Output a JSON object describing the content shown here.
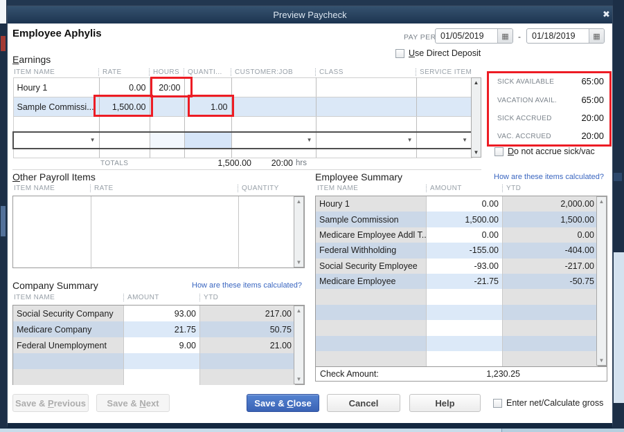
{
  "window": {
    "title": "Preview Paycheck",
    "close_icon": "✖"
  },
  "header": {
    "employee_name": "Employee Aphylis",
    "pay_period_label": {
      "pre": "PAY PER",
      "key": "I",
      "post": "OD"
    },
    "pay_period_start": "01/05/2019",
    "pay_period_separator": "-",
    "pay_period_end": "01/18/2019",
    "calendar_icon": "▦",
    "use_direct_deposit": {
      "pre": "",
      "key": "U",
      "post": "se Direct Deposit"
    }
  },
  "earnings": {
    "title": {
      "pre": "",
      "key": "E",
      "post": "arnings"
    },
    "columns": [
      "ITEM NAME",
      "RATE",
      "HOURS",
      "QUANTI...",
      "CUSTOMER:JOB",
      "CLASS",
      "SERVICE ITEM"
    ],
    "rows": [
      {
        "item": "Houry 1",
        "rate": "0.00",
        "hours": "20:00",
        "quantity": "",
        "customer_job": "",
        "class": "",
        "service_item": ""
      },
      {
        "item": "Sample Commissi...",
        "rate": "1,500.00",
        "hours": "",
        "quantity": "1.00",
        "customer_job": "",
        "class": "",
        "service_item": ""
      },
      {
        "item": "",
        "rate": "",
        "hours": "",
        "quantity": "",
        "customer_job": "",
        "class": "",
        "service_item": ""
      },
      {
        "item": "",
        "rate": "",
        "hours": "",
        "quantity": "",
        "customer_job": "",
        "class": "",
        "service_item": ""
      },
      {
        "item": "",
        "rate": "",
        "hours": "",
        "quantity": "",
        "customer_job": "",
        "class": "",
        "service_item": ""
      }
    ],
    "dropdown_icon": "▼",
    "totals_label": "TOTALS",
    "totals": {
      "rate": "1,500.00",
      "hours": "20:00",
      "hours_unit": "hrs"
    }
  },
  "sick_vacation": {
    "rows": [
      {
        "label": "SICK AVAILABLE",
        "value": "65:00"
      },
      {
        "label": "VACATION AVAIL.",
        "value": "65:00"
      },
      {
        "label": "SICK ACCRUED",
        "value": "20:00"
      },
      {
        "label": "VAC. ACCRUED",
        "value": "20:00"
      }
    ],
    "do_not_accrue": {
      "pre": "",
      "key": "D",
      "post": "o not accrue sick/vac"
    }
  },
  "other_payroll_items": {
    "title": {
      "pre": "",
      "key": "O",
      "post": "ther Payroll Items"
    },
    "columns": [
      "ITEM NAME",
      "RATE",
      "QUANTITY"
    ]
  },
  "employee_summary": {
    "title": "Employee Summary",
    "link": "How are these items calculated?",
    "columns": [
      "ITEM NAME",
      "AMOUNT",
      "YTD"
    ],
    "rows": [
      [
        "Houry 1",
        "0.00",
        "2,000.00"
      ],
      [
        "Sample Commission",
        "1,500.00",
        "1,500.00"
      ],
      [
        "Medicare Employee Addl T...",
        "0.00",
        "0.00"
      ],
      [
        "Federal Withholding",
        "-155.00",
        "-404.00"
      ],
      [
        "Social Security Employee",
        "-93.00",
        "-217.00"
      ],
      [
        "Medicare Employee",
        "-21.75",
        "-50.75"
      ],
      [
        "",
        "",
        ""
      ],
      [
        "",
        "",
        ""
      ],
      [
        "",
        "",
        ""
      ],
      [
        "",
        "",
        ""
      ],
      [
        "",
        "",
        ""
      ]
    ],
    "check_amount_label": "Check Amount:",
    "check_amount_value": "1,230.25"
  },
  "company_summary": {
    "title": "Company Summary",
    "link": "How are these items calculated?",
    "columns": [
      "ITEM NAME",
      "AMOUNT",
      "YTD"
    ],
    "rows": [
      [
        "Social Security Company",
        "93.00",
        "217.00"
      ],
      [
        "Medicare Company",
        "21.75",
        "50.75"
      ],
      [
        "Federal Unemployment",
        "9.00",
        "21.00"
      ],
      [
        "",
        "",
        ""
      ],
      [
        "",
        "",
        ""
      ]
    ]
  },
  "footer": {
    "save_previous": {
      "pre": "Save & ",
      "key": "P",
      "post": "revious"
    },
    "save_next": {
      "pre": "Save & ",
      "key": "N",
      "post": "ext"
    },
    "save_close": {
      "pre": "Save & ",
      "key": "C",
      "post": "lose"
    },
    "cancel": "Cancel",
    "help": "Help",
    "enter_net": {
      "pre": "Enter net/Calculate ",
      "key": "g",
      "post": "ross"
    }
  },
  "colors": {
    "annotation_red": "#ed1c24",
    "titlebar_navy": "#24405e",
    "link_blue": "#3a66c0",
    "primary_button_blue": "#3f6bbf",
    "row_highlight_blue": "#dbe8f7"
  }
}
